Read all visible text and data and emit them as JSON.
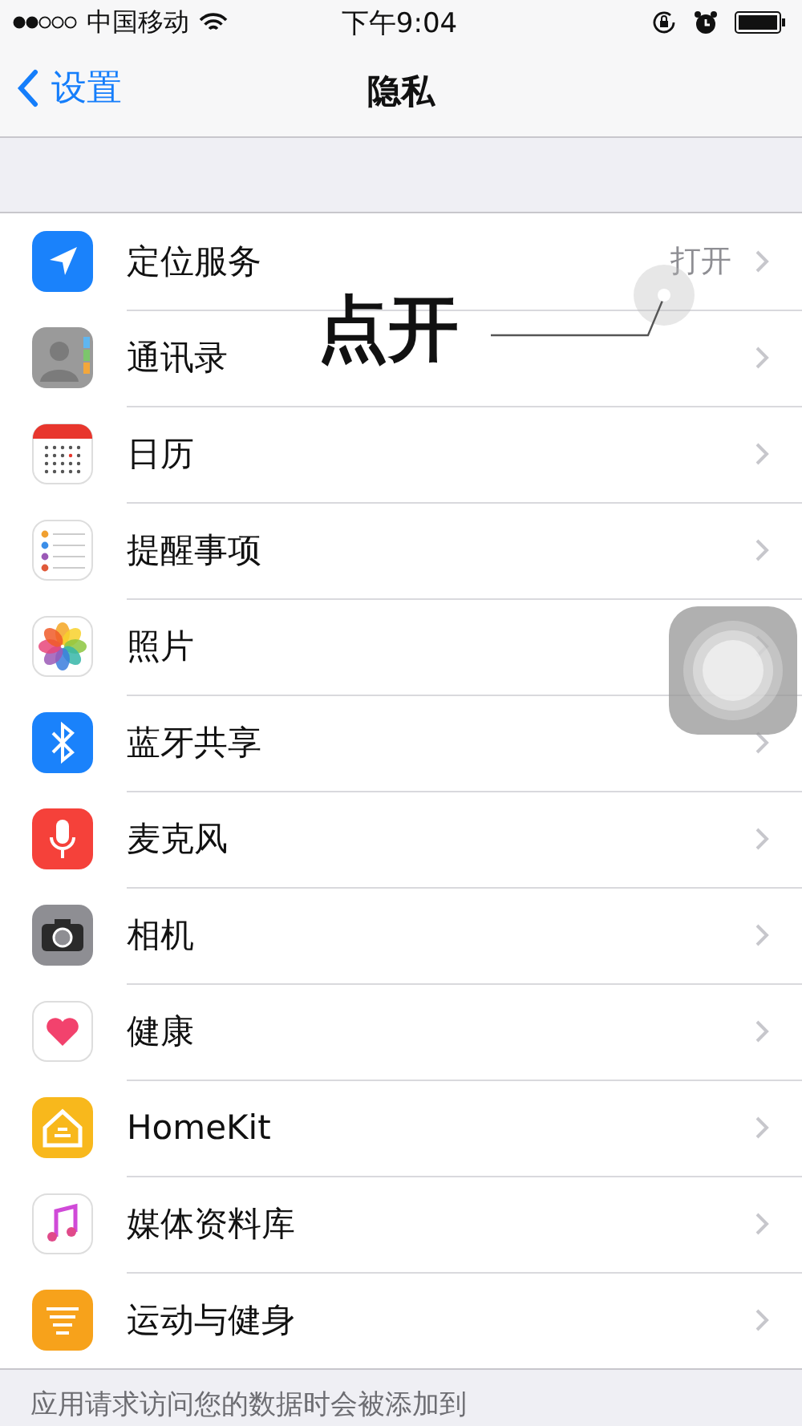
{
  "status_bar": {
    "carrier": "中国移动",
    "time": "下午9:04"
  },
  "nav": {
    "back": "设置",
    "title": "隐私"
  },
  "rows": [
    {
      "label": "定位服务",
      "value": "打开"
    },
    {
      "label": "通讯录"
    },
    {
      "label": "日历"
    },
    {
      "label": "提醒事项"
    },
    {
      "label": "照片"
    },
    {
      "label": "蓝牙共享"
    },
    {
      "label": "麦克风"
    },
    {
      "label": "相机"
    },
    {
      "label": "健康"
    },
    {
      "label": "HomeKit"
    },
    {
      "label": "媒体资料库"
    },
    {
      "label": "运动与健身"
    }
  ],
  "annotation": {
    "text": "点开"
  },
  "footer": "应用请求访问您的数据时会被添加到"
}
